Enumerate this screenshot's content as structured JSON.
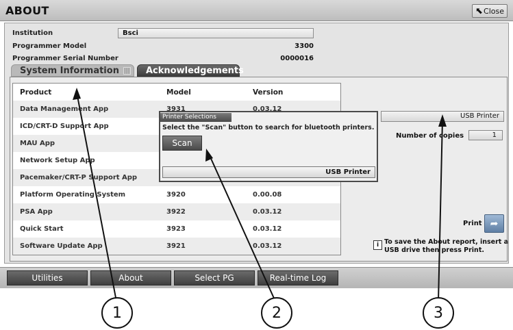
{
  "window": {
    "title": "ABOUT",
    "close_label": "Close"
  },
  "info": {
    "institution_label": "Institution",
    "institution_value": "Bsci",
    "model_label": "Programmer Model",
    "model_value": "3300",
    "serial_label": "Programmer Serial Number",
    "serial_value": "0000016"
  },
  "tabs": [
    {
      "label": "System Information"
    },
    {
      "label": "Acknowledgements"
    }
  ],
  "table": {
    "headers": [
      "Product",
      "Model",
      "Version"
    ],
    "rows": [
      [
        "Data Management App",
        "3931",
        "0.03.12"
      ],
      [
        "ICD/CRT-D Support App",
        "",
        ""
      ],
      [
        "MAU App",
        "",
        ""
      ],
      [
        "Network Setup App",
        "",
        ""
      ],
      [
        "Pacemaker/CRT-P Support App",
        "",
        ""
      ],
      [
        "Platform Operating System",
        "3920",
        "0.00.08"
      ],
      [
        "PSA App",
        "3922",
        "0.03.12"
      ],
      [
        "Quick Start",
        "3923",
        "0.03.12"
      ],
      [
        "Software Update App",
        "3921",
        "0.03.12"
      ]
    ]
  },
  "printer": {
    "selected": "USB Printer",
    "copies_label": "Number of copies",
    "copies_value": "1",
    "print_label": "Print",
    "info_text": "To save the About report, insert a USB drive then press Print."
  },
  "popup": {
    "title": "Printer Selections",
    "message": "Select the \"Scan\" button to search for bluetooth printers.",
    "scan_label": "Scan",
    "printer_value": "USB Printer"
  },
  "nav": [
    {
      "label": "Utilities"
    },
    {
      "label": "About"
    },
    {
      "label": "Select PG"
    },
    {
      "label": "Real-time Log"
    }
  ],
  "callouts": [
    "1",
    "2",
    "3"
  ]
}
